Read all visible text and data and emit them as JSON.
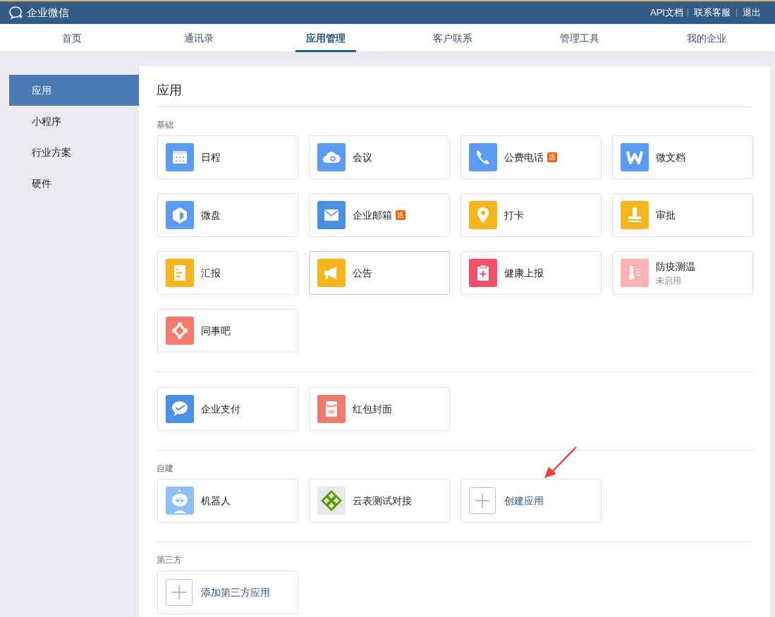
{
  "header": {
    "logo_text": "企业微信",
    "links": [
      "API文档",
      "联系客服",
      "退出"
    ]
  },
  "tabs": [
    {
      "label": "首页",
      "selected": false
    },
    {
      "label": "通讯录",
      "selected": false
    },
    {
      "label": "应用管理",
      "selected": true
    },
    {
      "label": "客户联系",
      "selected": false
    },
    {
      "label": "管理工具",
      "selected": false
    },
    {
      "label": "我的企业",
      "selected": false
    }
  ],
  "sidebar": {
    "items": [
      {
        "label": "应用",
        "selected": true
      },
      {
        "label": "小程序",
        "selected": false
      },
      {
        "label": "行业方案",
        "selected": false
      },
      {
        "label": "硬件",
        "selected": false
      }
    ]
  },
  "main": {
    "title": "应用",
    "sections": [
      {
        "label": "基础",
        "apps": [
          {
            "kind": "app",
            "name": "日程",
            "color": "#5b9bf5",
            "enabled": true,
            "highlighted": false
          },
          {
            "kind": "app",
            "name": "会议",
            "color": "#5b9bf5",
            "enabled": true,
            "highlighted": false
          },
          {
            "kind": "app",
            "name": "公费电话",
            "badge": "送",
            "color": "#5b9bf5",
            "enabled": true,
            "highlighted": false
          },
          {
            "kind": "app",
            "name": "微文档",
            "color": "#5b9bf5",
            "enabled": true,
            "highlighted": false
          },
          {
            "kind": "app",
            "name": "微盘",
            "color": "#5b9bf5",
            "enabled": true,
            "highlighted": false
          },
          {
            "kind": "app",
            "name": "企业邮箱",
            "badge": "送",
            "color": "#4a90e2",
            "enabled": true,
            "highlighted": false
          },
          {
            "kind": "app",
            "name": "打卡",
            "color": "#f5b51e",
            "enabled": true,
            "highlighted": false
          },
          {
            "kind": "app",
            "name": "审批",
            "color": "#f5b51e",
            "enabled": true,
            "highlighted": false
          },
          {
            "kind": "app",
            "name": "汇报",
            "color": "#f5b51e",
            "enabled": true,
            "highlighted": false
          },
          {
            "kind": "app",
            "name": "公告",
            "color": "#f5b51e",
            "enabled": true,
            "highlighted": true
          },
          {
            "kind": "app",
            "name": "健康上报",
            "color": "#f5506a",
            "enabled": true,
            "highlighted": false
          },
          {
            "kind": "app",
            "name": "防疫测温",
            "status": "未启用",
            "color": "#ffb1b1",
            "enabled": false,
            "highlighted": false
          },
          {
            "kind": "app",
            "name": "同事吧",
            "color": "#fb7a6e",
            "enabled": true,
            "highlighted": false
          }
        ]
      },
      {
        "apps": [
          {
            "kind": "app",
            "name": "企业支付",
            "color": "#4a90e2",
            "enabled": true,
            "highlighted": false
          },
          {
            "kind": "app",
            "name": "红包封面",
            "color": "#f07a6e",
            "enabled": true,
            "highlighted": false
          }
        ]
      },
      {
        "label": "自建",
        "apps": [
          {
            "kind": "app",
            "name": "机器人",
            "color": "#8ec0f7",
            "enabled": true,
            "highlighted": false
          },
          {
            "kind": "app",
            "name": "云表测试对接",
            "color": "#e8e8e8",
            "enabled": true,
            "highlighted": false
          },
          {
            "kind": "add",
            "name": "创建应用",
            "highlighted": false
          }
        ]
      },
      {
        "label": "第三方",
        "apps": [
          {
            "kind": "add",
            "name": "添加第三方应用",
            "highlighted": false
          }
        ]
      }
    ]
  }
}
